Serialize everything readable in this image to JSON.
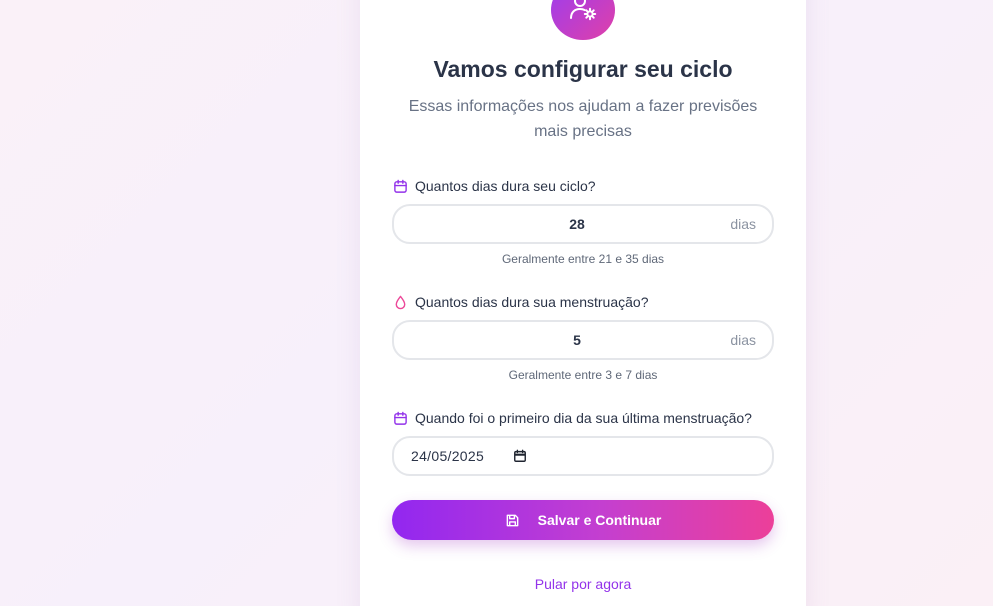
{
  "header": {
    "title": "Vamos configurar seu ciclo",
    "subtitle": "Essas informações nos ajudam a fazer previsões mais precisas",
    "avatar_icon": "user-gear-icon"
  },
  "cycle": {
    "label": "Quantos dias dura seu ciclo?",
    "icon": "calendar-icon",
    "value": "28",
    "suffix": "dias",
    "hint": "Geralmente entre 21 e 35 dias"
  },
  "period": {
    "label": "Quantos dias dura sua menstruação?",
    "icon": "droplet-icon",
    "value": "5",
    "suffix": "dias",
    "hint": "Geralmente entre 3 e 7 dias"
  },
  "last_period": {
    "label": "Quando foi o primeiro dia da sua última menstruação?",
    "icon": "calendar-icon",
    "value": "24/05/2025",
    "picker_icon": "calendar-picker-icon"
  },
  "actions": {
    "save_label": "Salvar e Continuar",
    "save_icon": "save-icon",
    "skip_label": "Pular por agora"
  },
  "colors": {
    "accent_purple": "#9333ea",
    "accent_pink": "#ec4899",
    "title_text": "#2b3448"
  }
}
